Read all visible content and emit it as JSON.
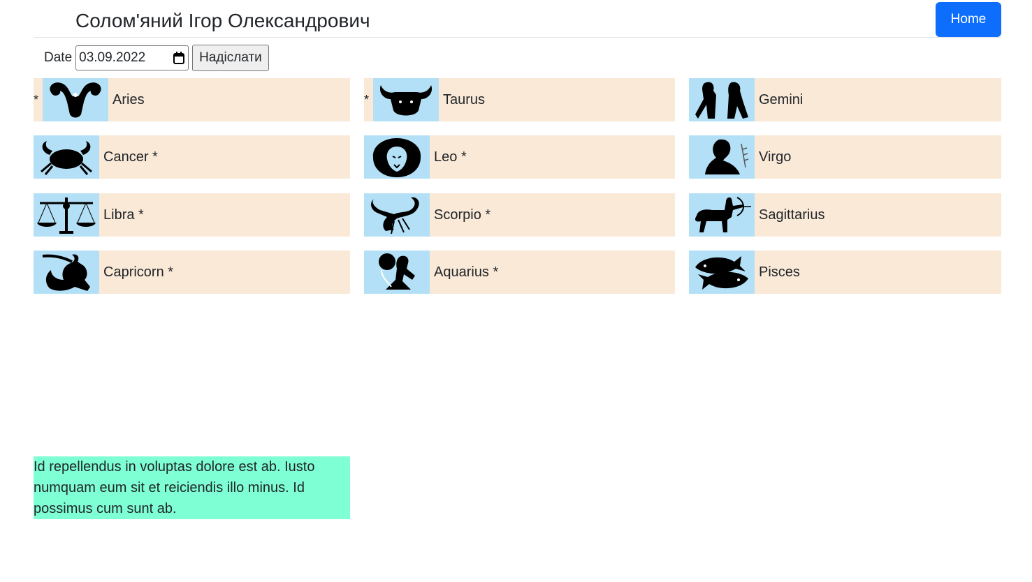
{
  "header": {
    "title": "Солом'яний Ігор Олександрович",
    "home_label": "Home"
  },
  "form": {
    "date_label": "Date",
    "date_value": "03.09.2022",
    "submit_label": "Надіслати"
  },
  "signs": [
    {
      "name": "Aries",
      "star_before": "*",
      "star_after": "",
      "icon": "aries-icon"
    },
    {
      "name": "Taurus",
      "star_before": "*",
      "star_after": "",
      "icon": "taurus-icon"
    },
    {
      "name": "Gemini",
      "star_before": "",
      "star_after": "",
      "icon": "gemini-icon"
    },
    {
      "name": "Cancer",
      "star_before": "",
      "star_after": "*",
      "icon": "cancer-icon"
    },
    {
      "name": "Leo",
      "star_before": "",
      "star_after": "*",
      "icon": "leo-icon"
    },
    {
      "name": "Virgo",
      "star_before": "",
      "star_after": "",
      "icon": "virgo-icon"
    },
    {
      "name": "Libra",
      "star_before": "",
      "star_after": "*",
      "icon": "libra-icon"
    },
    {
      "name": "Scorpio",
      "star_before": "",
      "star_after": "*",
      "icon": "scorpio-icon"
    },
    {
      "name": "Sagittarius",
      "star_before": "",
      "star_after": "",
      "icon": "sagittarius-icon"
    },
    {
      "name": "Capricorn",
      "star_before": "",
      "star_after": "*",
      "icon": "capricorn-icon"
    },
    {
      "name": "Aquarius",
      "star_before": "",
      "star_after": "*",
      "icon": "aquarius-icon"
    },
    {
      "name": "Pisces",
      "star_before": "",
      "star_after": "",
      "icon": "pisces-icon"
    }
  ],
  "note": {
    "text": "Id repellendus in voluptas dolore est ab. Iusto numquam eum sit et reiciendis illo minus. Id possimus cum sunt ab."
  },
  "colors": {
    "primary": "#0d6efd",
    "tile_bg": "#fae9d7",
    "icon_bg": "#b3e0f6",
    "note_bg": "#7fffd4"
  }
}
